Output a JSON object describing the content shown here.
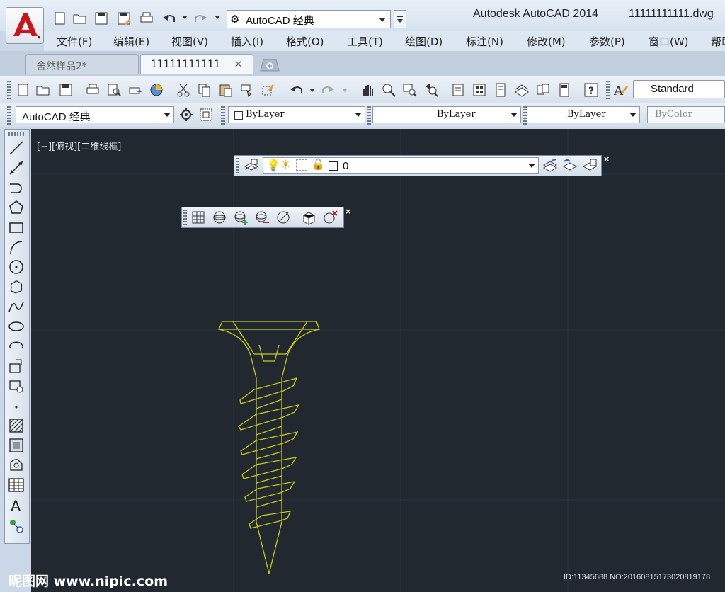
{
  "window": {
    "app_title": "Autodesk AutoCAD 2014",
    "file_title": "11111111111.dwg"
  },
  "quick_access": {
    "workspace": "AutoCAD 经典"
  },
  "menubar": {
    "items": [
      "文件(F)",
      "编辑(E)",
      "视图(V)",
      "插入(I)",
      "格式(O)",
      "工具(T)",
      "绘图(D)",
      "标注(N)",
      "修改(M)",
      "参数(P)",
      "窗口(W)",
      "帮助"
    ]
  },
  "tabs": {
    "items": [
      {
        "label": "舍然样品2*"
      },
      {
        "label": "11111111111",
        "close": "×"
      }
    ]
  },
  "standard_toolbar": {
    "text_style": "Standard"
  },
  "properties_toolbar": {
    "workspace": "AutoCAD 经典",
    "color": "ByLayer",
    "linetype": "ByLayer",
    "lineweight": "ByLayer",
    "plotstyle": "ByColor"
  },
  "layer_toolbar": {
    "current_layer": "0"
  },
  "viewport": {
    "label": "[−][俯视][二维线框]"
  },
  "watermark": {
    "site": "昵图网 www.nipic.com",
    "id": "ID:11345688 NO:20160815173020819178"
  },
  "colors": {
    "canvas": "#212830",
    "drawing_line": "#c8c81e",
    "grid": "#2c3440"
  }
}
